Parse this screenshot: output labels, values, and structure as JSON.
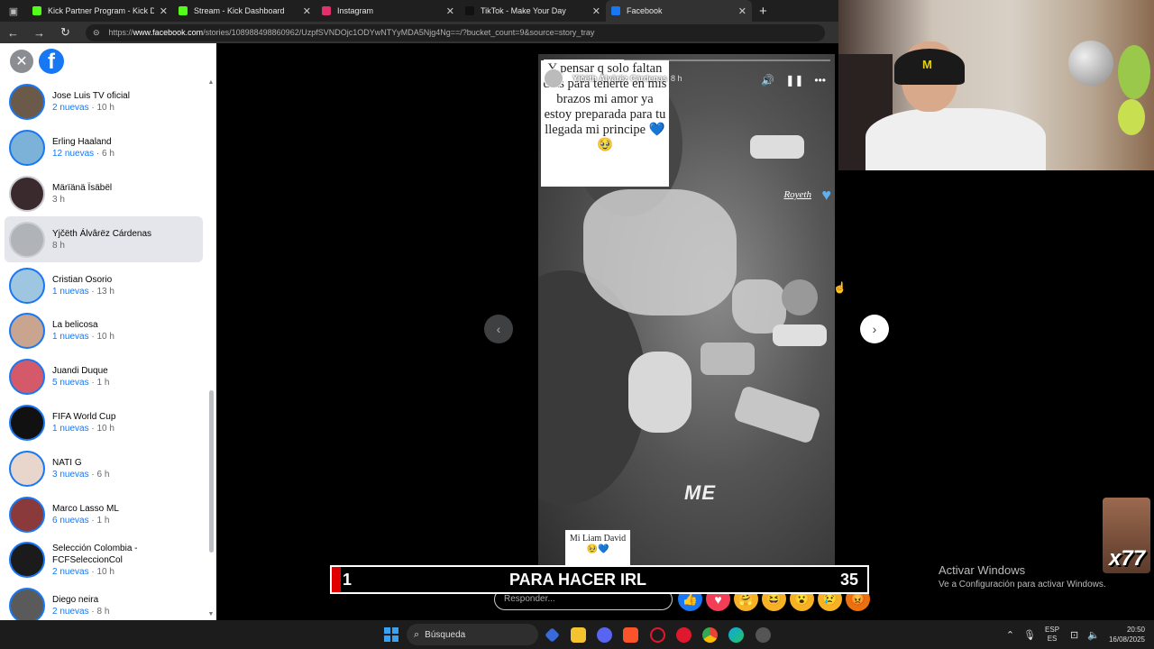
{
  "tabs": [
    {
      "label": "Kick Partner Program - Kick Dash",
      "color": "#53fc18",
      "active": false
    },
    {
      "label": "Stream - Kick Dashboard",
      "color": "#53fc18",
      "active": false
    },
    {
      "label": "Instagram",
      "color": "#e1306c",
      "active": false
    },
    {
      "label": "TikTok - Make Your Day",
      "color": "#111111",
      "active": false
    },
    {
      "label": "Facebook",
      "color": "#1877f2",
      "active": true
    }
  ],
  "address": {
    "prefix": "https://",
    "host": "www.facebook.com",
    "path": "/stories/108988498860962/UzpfSVNDOjc1ODYwNTYyMDA5Njg4Ng==/?bucket_count=9&source=story_tray"
  },
  "sidebar": {
    "logo": "f",
    "stories": [
      {
        "name": "Jose Luis TV oficial",
        "new": "2 nuevas",
        "time": "10 h",
        "seen": false,
        "avatar_color": "#6b5a4a"
      },
      {
        "name": "Erling Haaland",
        "new": "12 nuevas",
        "time": "6 h",
        "seen": false,
        "avatar_color": "#7db2d8"
      },
      {
        "name": "Märïänä Ïsäbël",
        "new": "",
        "time": "3 h",
        "seen": true,
        "avatar_color": "#3a2a2e"
      },
      {
        "name": "Yjčëth Álvârëz Cárdenas",
        "new": "",
        "time": "8 h",
        "seen": true,
        "avatar_color": "#b0b3b8",
        "selected": true
      },
      {
        "name": "Cristian Osorio",
        "new": "1 nuevas",
        "time": "13 h",
        "seen": false,
        "avatar_color": "#9fc6e0"
      },
      {
        "name": "La belicosa",
        "new": "1 nuevas",
        "time": "10 h",
        "seen": false,
        "avatar_color": "#c9a48e"
      },
      {
        "name": "Juandi Duque",
        "new": "5 nuevas",
        "time": "1 h",
        "seen": false,
        "avatar_color": "#d45a6a"
      },
      {
        "name": "FIFA World Cup",
        "new": "1 nuevas",
        "time": "10 h",
        "seen": false,
        "avatar_color": "#111111"
      },
      {
        "name": "NATI G",
        "new": "3 nuevas",
        "time": "6 h",
        "seen": false,
        "avatar_color": "#e8d6cc"
      },
      {
        "name": "Marco Lasso ML",
        "new": "6 nuevas",
        "time": "1 h",
        "seen": false,
        "avatar_color": "#8a3a3a"
      },
      {
        "name": "Selección Colombia - FCFSeleccionCol",
        "new": "2 nuevas",
        "time": "10 h",
        "seen": false,
        "avatar_color": "#1b1b1b"
      },
      {
        "name": "Diego neira",
        "new": "2 nuevas",
        "time": "8 h",
        "seen": false,
        "avatar_color": "#5a5a5a"
      }
    ]
  },
  "story": {
    "author": "Yjčëth Álvârëz Cárdenas",
    "time": "8 h",
    "progress": 0.28,
    "caption": "Y pensar q solo faltan días para tenerte en mis brazos mi amor ya estoy preparada para tu llegada mi principe 💙🥹",
    "signature": "Royeth",
    "sticker_text": "ME",
    "note": "Mi Liam David 🥹💙",
    "reply_placeholder": "Responder...",
    "reactions": [
      {
        "name": "like",
        "glyph": "👍",
        "color": "#1877f2"
      },
      {
        "name": "love",
        "glyph": "♥",
        "color": "#f33e58"
      },
      {
        "name": "care",
        "glyph": "🤗",
        "color": "#f7b125"
      },
      {
        "name": "haha",
        "glyph": "😆",
        "color": "#f7b125"
      },
      {
        "name": "wow",
        "glyph": "😮",
        "color": "#f7b125"
      },
      {
        "name": "sad",
        "glyph": "😢",
        "color": "#f7b125"
      },
      {
        "name": "angry",
        "glyph": "😡",
        "color": "#e9710f"
      }
    ]
  },
  "overlay": {
    "left_number": "1",
    "title": "PARA HACER IRL",
    "right_number": "35"
  },
  "watermark": {
    "line1": "Activar Windows",
    "line2": "Ve a Configuración para activar Windows."
  },
  "emote_text": "x77",
  "taskbar": {
    "search_label": "Búsqueda",
    "lang_top": "ESP",
    "lang_bottom": "ES",
    "time": "20:50",
    "date": "16/08/2025"
  }
}
